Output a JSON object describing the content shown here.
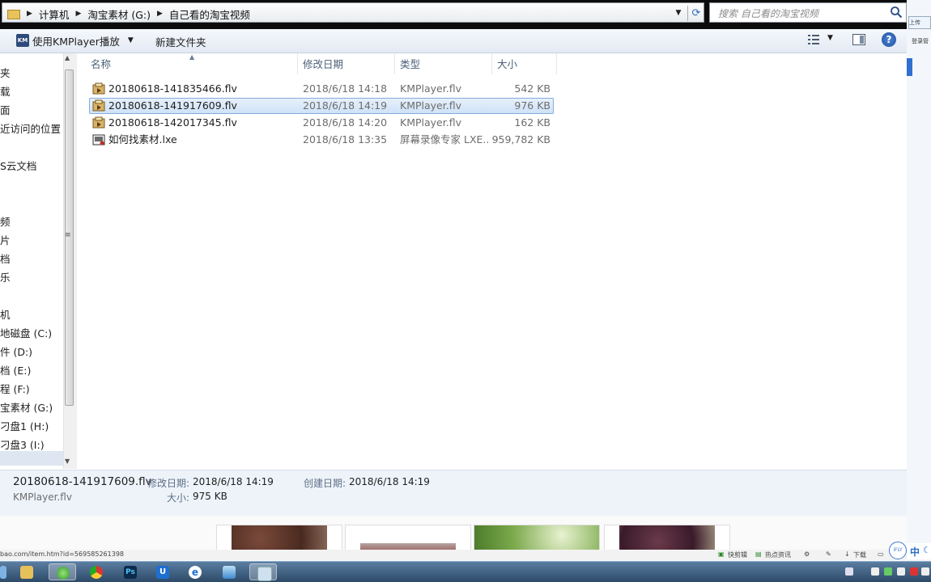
{
  "address_bar": {
    "crumbs": [
      "计算机",
      "淘宝素材 (G:)",
      "自己看的淘宝视频"
    ],
    "search_placeholder": "搜索 自己看的淘宝视频"
  },
  "toolbar": {
    "play_label": "使用KMPlayer播放",
    "new_folder_label": "新建文件夹",
    "km_icon_text": "KM"
  },
  "nav_items": [
    "夹",
    "载",
    "面",
    "近访问的位置",
    "S云文档",
    "频",
    "片",
    "档",
    "乐",
    "机",
    "地磁盘 (C:)",
    "件 (D:)",
    "档 (E:)",
    "程 (F:)",
    "宝素材 (G:)",
    "刁盘1 (H:)",
    "刁盘3 (I:)"
  ],
  "columns": {
    "name": "名称",
    "date": "修改日期",
    "type": "类型",
    "size": "大小"
  },
  "files": [
    {
      "name": "20180618-141835466.flv",
      "date": "2018/6/18 14:18",
      "type": "KMPlayer.flv",
      "size": "542 KB",
      "icon": "flv-file-icon",
      "selected": false
    },
    {
      "name": "20180618-141917609.flv",
      "date": "2018/6/18 14:19",
      "type": "KMPlayer.flv",
      "size": "976 KB",
      "icon": "flv-file-icon",
      "selected": true
    },
    {
      "name": "20180618-142017345.flv",
      "date": "2018/6/18 14:20",
      "type": "KMPlayer.flv",
      "size": "162 KB",
      "icon": "flv-file-icon",
      "selected": false
    },
    {
      "name": "如何找素材.lxe",
      "date": "2018/6/18 13:35",
      "type": "屏幕录像专家 LXE...",
      "size": "959,782 KB",
      "icon": "lxe-file-icon",
      "selected": false
    }
  ],
  "details": {
    "name": "20180618-141917609.flv",
    "type": "KMPlayer.flv",
    "modified_label": "修改日期:",
    "modified_value": "2018/6/18 14:19",
    "created_label": "创建日期:",
    "created_value": "2018/6/18 14:19",
    "size_label": "大小:",
    "size_value": "975 KB"
  },
  "browser_status": {
    "url": "bao.com/item.htm?id=569585261398",
    "quick_clip": "快剪辑",
    "hot_news": "热点资讯",
    "download": "下载",
    "ime": "中"
  },
  "right_window": {
    "label1": "上传",
    "label2": "登录管"
  },
  "colors": {
    "selection_bg": "#cfe2f7",
    "selection_border": "#84acdd",
    "details_bg": "#eef3fa",
    "taskbar": "#2d4a69"
  }
}
